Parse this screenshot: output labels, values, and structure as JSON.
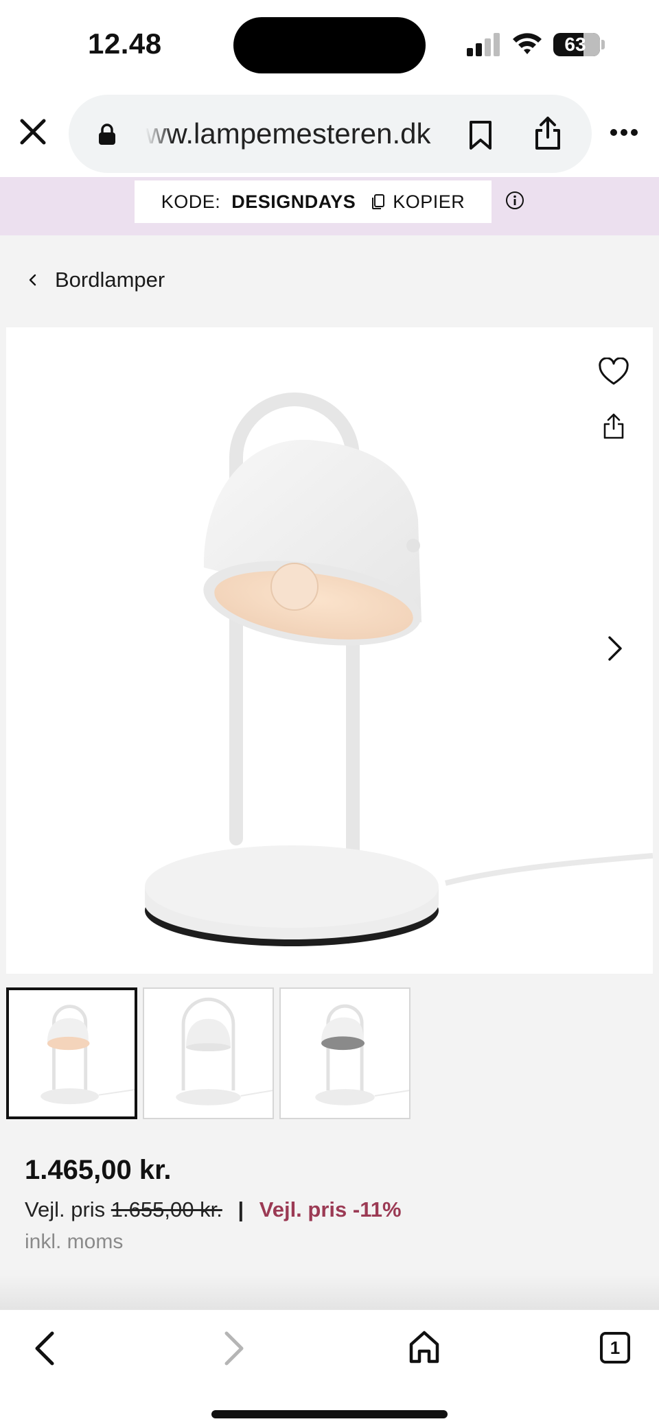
{
  "status_bar": {
    "time": "12.48",
    "battery": "63",
    "icons": [
      "signal-icon",
      "wifi-icon",
      "battery-icon"
    ]
  },
  "browser": {
    "url": "ww.lampemesteren.dk",
    "icons": [
      "close-icon",
      "lock-icon",
      "bookmark-icon",
      "share-icon",
      "more-icon"
    ]
  },
  "promo": {
    "code_label": "KODE:",
    "code": "DESIGNDAYS",
    "copy_label": "KOPIER",
    "background": "#ece0ef"
  },
  "breadcrumb": {
    "label": "Bordlamper"
  },
  "product": {
    "image_count": 3,
    "active_image": 1,
    "price": "1.465,00 kr.",
    "rrp_label": "Vejl. pris",
    "rrp_old": "1.655,00 kr.",
    "rrp_separator": "|",
    "discount_label": "Vejl. pris -11%",
    "vat_note": "inkl. moms",
    "discount_color": "#9b3a54"
  },
  "toolbar": {
    "tabs_count": "1",
    "icons": [
      "back-icon",
      "forward-icon",
      "home-icon",
      "tabs-icon"
    ]
  }
}
